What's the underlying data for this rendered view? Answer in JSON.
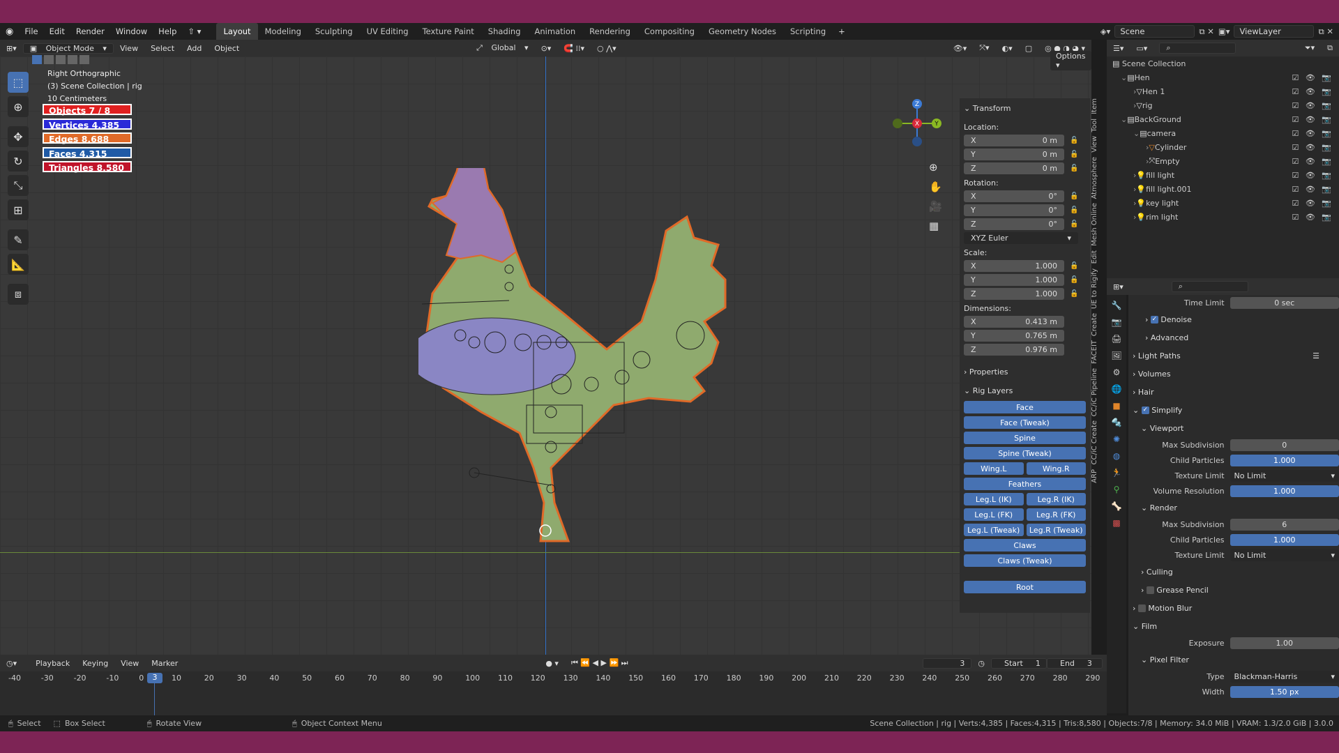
{
  "menu": [
    "File",
    "Edit",
    "Render",
    "Window",
    "Help"
  ],
  "workspaces": [
    "Layout",
    "Modeling",
    "Sculpting",
    "UV Editing",
    "Texture Paint",
    "Shading",
    "Animation",
    "Rendering",
    "Compositing",
    "Geometry Nodes",
    "Scripting"
  ],
  "active_workspace": "Layout",
  "scene": {
    "label": "Scene",
    "view_layer": "ViewLayer"
  },
  "viewport_header": {
    "mode": "Object Mode",
    "items": [
      "View",
      "Select",
      "Add",
      "Object"
    ],
    "orientation": "Global",
    "options": "Options"
  },
  "overlay_info": {
    "view": "Right Orthographic",
    "collection": "(3) Scene Collection | rig",
    "scale": "10 Centimeters"
  },
  "stats": [
    {
      "label": "Objects 7 / 8",
      "color": "#e02020"
    },
    {
      "label": "Vertices 4,385",
      "color": "#2a2ad8"
    },
    {
      "label": "Edges 8,688",
      "color": "#e06a28"
    },
    {
      "label": "Faces 4,315",
      "color": "#1f5aa6"
    },
    {
      "label": "Triangles 8,580",
      "color": "#c0142a"
    }
  ],
  "transform": {
    "title": "Transform",
    "location_label": "Location:",
    "location": [
      {
        "axis": "X",
        "v": "0 m"
      },
      {
        "axis": "Y",
        "v": "0 m"
      },
      {
        "axis": "Z",
        "v": "0 m"
      }
    ],
    "rotation_label": "Rotation:",
    "rotation": [
      {
        "axis": "X",
        "v": "0°"
      },
      {
        "axis": "Y",
        "v": "0°"
      },
      {
        "axis": "Z",
        "v": "0°"
      }
    ],
    "rotation_mode": "XYZ Euler",
    "scale_label": "Scale:",
    "scale": [
      {
        "axis": "X",
        "v": "1.000"
      },
      {
        "axis": "Y",
        "v": "1.000"
      },
      {
        "axis": "Z",
        "v": "1.000"
      }
    ],
    "dimensions_label": "Dimensions:",
    "dimensions": [
      {
        "axis": "X",
        "v": "0.413 m"
      },
      {
        "axis": "Y",
        "v": "0.765 m"
      },
      {
        "axis": "Z",
        "v": "0.976 m"
      }
    ]
  },
  "properties_label": "Properties",
  "rig_layers": {
    "title": "Rig Layers",
    "rows": [
      [
        "Face"
      ],
      [
        "Face (Tweak)"
      ],
      [
        "Spine"
      ],
      [
        "Spine (Tweak)"
      ],
      [
        "Wing.L",
        "Wing.R"
      ],
      [
        "Feathers"
      ],
      [
        "Leg.L (IK)",
        "Leg.R (IK)"
      ],
      [
        "Leg.L (FK)",
        "Leg.R (FK)"
      ],
      [
        "Leg.L (Tweak)",
        "Leg.R (Tweak)"
      ],
      [
        "Claws"
      ],
      [
        "Claws (Tweak)"
      ]
    ],
    "root": "Root"
  },
  "side_tabs": [
    "Item",
    "Tool",
    "View",
    "Atmosphere",
    "Mesh Online",
    "Edit",
    "UE to Rigify",
    "Create",
    "FACEIT",
    "CC/iC Pipeline",
    "CC/iC Create",
    "ARP"
  ],
  "outliner": {
    "root": "Scene Collection",
    "rows": [
      {
        "name": "Hen",
        "indent": 0,
        "type": "collection"
      },
      {
        "name": "Hen 1",
        "indent": 1,
        "type": "object"
      },
      {
        "name": "rig",
        "indent": 1,
        "type": "object"
      },
      {
        "name": "BackGround",
        "indent": 0,
        "type": "collection"
      },
      {
        "name": "camera",
        "indent": 1,
        "type": "collection"
      },
      {
        "name": "Cylinder",
        "indent": 2,
        "type": "mesh"
      },
      {
        "name": "Empty",
        "indent": 2,
        "type": "empty"
      },
      {
        "name": "fill light",
        "indent": 1,
        "type": "light"
      },
      {
        "name": "fill light.001",
        "indent": 1,
        "type": "light"
      },
      {
        "name": "key light",
        "indent": 1,
        "type": "light"
      },
      {
        "name": "rim light",
        "indent": 1,
        "type": "light"
      }
    ]
  },
  "properties": {
    "time_limit": {
      "label": "Time Limit",
      "value": "0 sec"
    },
    "denoise": "Denoise",
    "advanced": "Advanced",
    "light_paths": "Light Paths",
    "volumes": "Volumes",
    "hair": "Hair",
    "simplify": "Simplify",
    "viewport": "Viewport",
    "vp_max_subdiv": {
      "label": "Max Subdivision",
      "value": "0"
    },
    "vp_child_particles": {
      "label": "Child Particles",
      "value": "1.000"
    },
    "vp_texture_limit": {
      "label": "Texture Limit",
      "value": "No Limit"
    },
    "vp_volume_res": {
      "label": "Volume Resolution",
      "value": "1.000"
    },
    "render": "Render",
    "r_max_subdiv": {
      "label": "Max Subdivision",
      "value": "6"
    },
    "r_child_particles": {
      "label": "Child Particles",
      "value": "1.000"
    },
    "r_texture_limit": {
      "label": "Texture Limit",
      "value": "No Limit"
    },
    "culling": "Culling",
    "grease_pencil": "Grease Pencil",
    "motion_blur": "Motion Blur",
    "film": "Film",
    "exposure": {
      "label": "Exposure",
      "value": "1.00"
    },
    "pixel_filter": "Pixel Filter",
    "pf_type": {
      "label": "Type",
      "value": "Blackman-Harris"
    },
    "pf_width": {
      "label": "Width",
      "value": "1.50 px"
    }
  },
  "timeline": {
    "menus": [
      "Playback",
      "Keying",
      "View",
      "Marker"
    ],
    "current": "3",
    "start_label": "Start",
    "start": "1",
    "end_label": "End",
    "end": "3",
    "ticks": [
      "-40",
      "-30",
      "-20",
      "-10",
      "0",
      "10",
      "20",
      "30",
      "40",
      "50",
      "60",
      "70",
      "80",
      "90",
      "100",
      "110",
      "120",
      "130",
      "140",
      "150",
      "160",
      "170",
      "180",
      "190",
      "200",
      "210",
      "220",
      "230",
      "240",
      "250",
      "260",
      "270",
      "280",
      "290"
    ],
    "playhead": "3"
  },
  "statusbar": {
    "select": "Select",
    "box_select": "Box Select",
    "rotate_view": "Rotate View",
    "context_menu": "Object Context Menu",
    "info": "Scene Collection | rig | Verts:4,385 | Faces:4,315 | Tris:8,580 | Objects:7/8 | Memory: 34.0 MiB | VRAM: 1.3/2.0 GiB | 3.0.0"
  },
  "colors": {
    "accent": "#4772b3",
    "bg": "#1d1d1d",
    "panel": "#2e2e2e",
    "viewport": "#393939",
    "border": "#7d2455"
  }
}
